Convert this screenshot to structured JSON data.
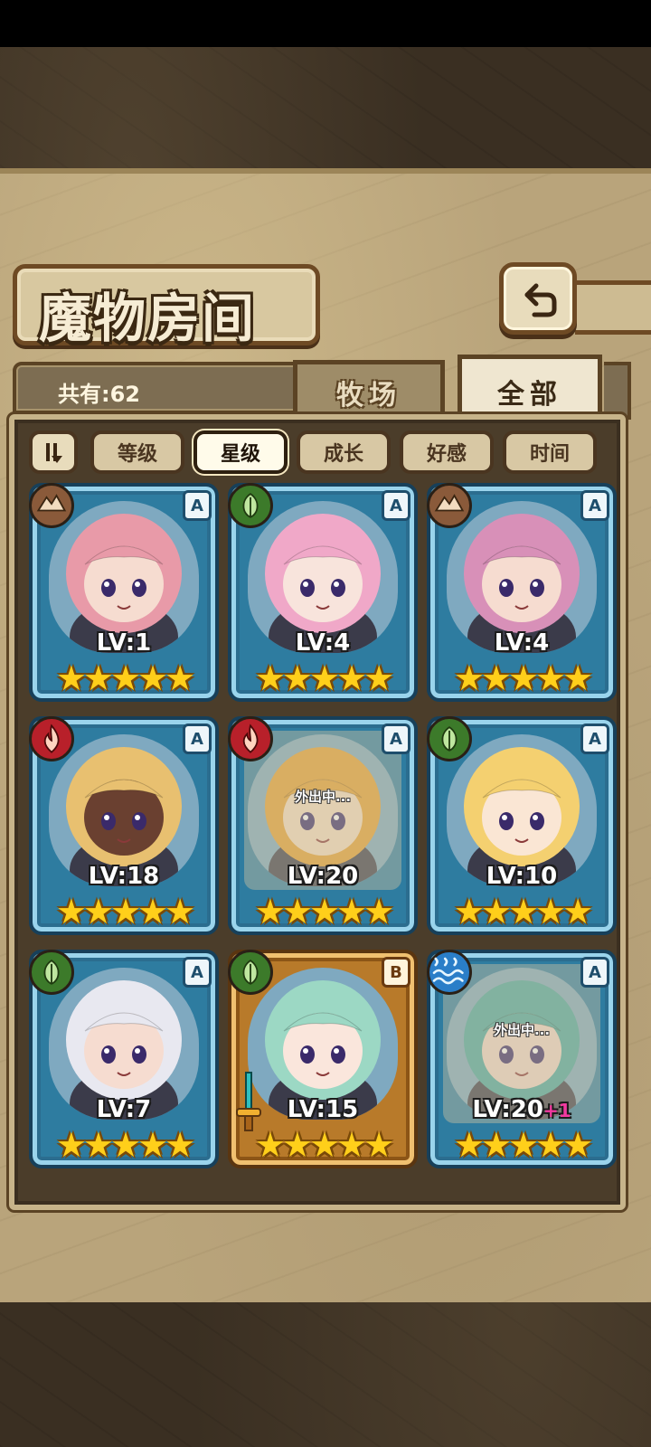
{
  "header": {
    "title": "魔物房间"
  },
  "summary": {
    "count_label": "共有:62"
  },
  "tabs": [
    {
      "label": "牧场",
      "active": false
    },
    {
      "label": "全部",
      "active": true
    }
  ],
  "sort_options": [
    {
      "label": "等级",
      "active": false
    },
    {
      "label": "星级",
      "active": true
    },
    {
      "label": "成长",
      "active": false
    },
    {
      "label": "好感",
      "active": false
    },
    {
      "label": "时间",
      "active": false
    }
  ],
  "colors": {
    "earth": "#8a5a3a",
    "nature": "#3c7a2a",
    "fire": "#b8202a",
    "water": "#2a7ec8",
    "card_a": "#2e7ca0",
    "card_b": "#b87a2a",
    "star": "#ffcf1a"
  },
  "monsters": [
    {
      "element": "earth-icon",
      "grade": "A",
      "level": "LV:1",
      "stars": "★★★★★",
      "away": "",
      "hair": "#e89aa8",
      "skin": "#f6dcd0"
    },
    {
      "element": "nature-icon",
      "grade": "A",
      "level": "LV:4",
      "stars": "★★★★★",
      "away": "",
      "hair": "#f0a8c8",
      "skin": "#f8e4dc"
    },
    {
      "element": "earth-icon",
      "grade": "A",
      "level": "LV:4",
      "stars": "★★★★★",
      "away": "",
      "hair": "#d890b8",
      "skin": "#f6dcd0"
    },
    {
      "element": "fire-icon",
      "grade": "A",
      "level": "LV:18",
      "stars": "★★★★★",
      "away": "",
      "hair": "#e8c070",
      "skin": "#6a4030"
    },
    {
      "element": "fire-icon",
      "grade": "A",
      "level": "LV:20",
      "stars": "★★★★★",
      "away": "外出中...",
      "hair": "#e8a030",
      "skin": "#f6dcc0"
    },
    {
      "element": "nature-icon",
      "grade": "A",
      "level": "LV:10",
      "stars": "★★★★★",
      "away": "",
      "hair": "#f4d070",
      "skin": "#fae6d4"
    },
    {
      "element": "nature-icon",
      "grade": "A",
      "level": "LV:7",
      "stars": "★★★★★",
      "away": "",
      "hair": "#e8e8f0",
      "skin": "#f6dcd0"
    },
    {
      "element": "nature-icon",
      "grade": "B",
      "level": "LV:15",
      "stars": "★★★★★",
      "away": "",
      "hair": "#9cd8c4",
      "skin": "#fae6dc"
    },
    {
      "element": "water-icon",
      "grade": "A",
      "level": "LV:20",
      "bonus": "+1",
      "stars": "★★★★★",
      "away": "外出中...",
      "hair": "#4aa8a0",
      "skin": "#f0d8c8"
    }
  ]
}
